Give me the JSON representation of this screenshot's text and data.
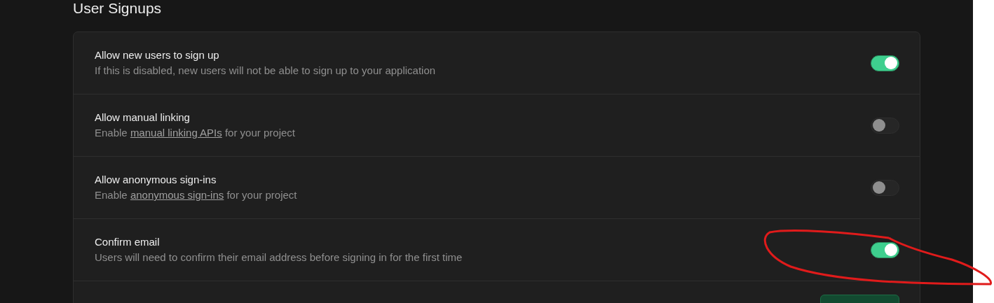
{
  "heading": "User Signups",
  "settings": [
    {
      "title": "Allow new users to sign up",
      "description": [
        {
          "kind": "text",
          "text": "If this is disabled, new users will not be able to sign up to your application"
        }
      ],
      "on": true
    },
    {
      "title": "Allow manual linking",
      "description": [
        {
          "kind": "text",
          "text": "Enable "
        },
        {
          "kind": "link",
          "text": "manual linking APIs"
        },
        {
          "kind": "text",
          "text": " for your project"
        }
      ],
      "on": false
    },
    {
      "title": "Allow anonymous sign-ins",
      "description": [
        {
          "kind": "text",
          "text": "Enable "
        },
        {
          "kind": "link",
          "text": "anonymous sign-ins"
        },
        {
          "kind": "text",
          "text": " for your project"
        }
      ],
      "on": false
    },
    {
      "title": "Confirm email",
      "description": [
        {
          "kind": "text",
          "text": "Users will need to confirm their email address before signing in for the first time"
        }
      ],
      "on": true
    }
  ]
}
